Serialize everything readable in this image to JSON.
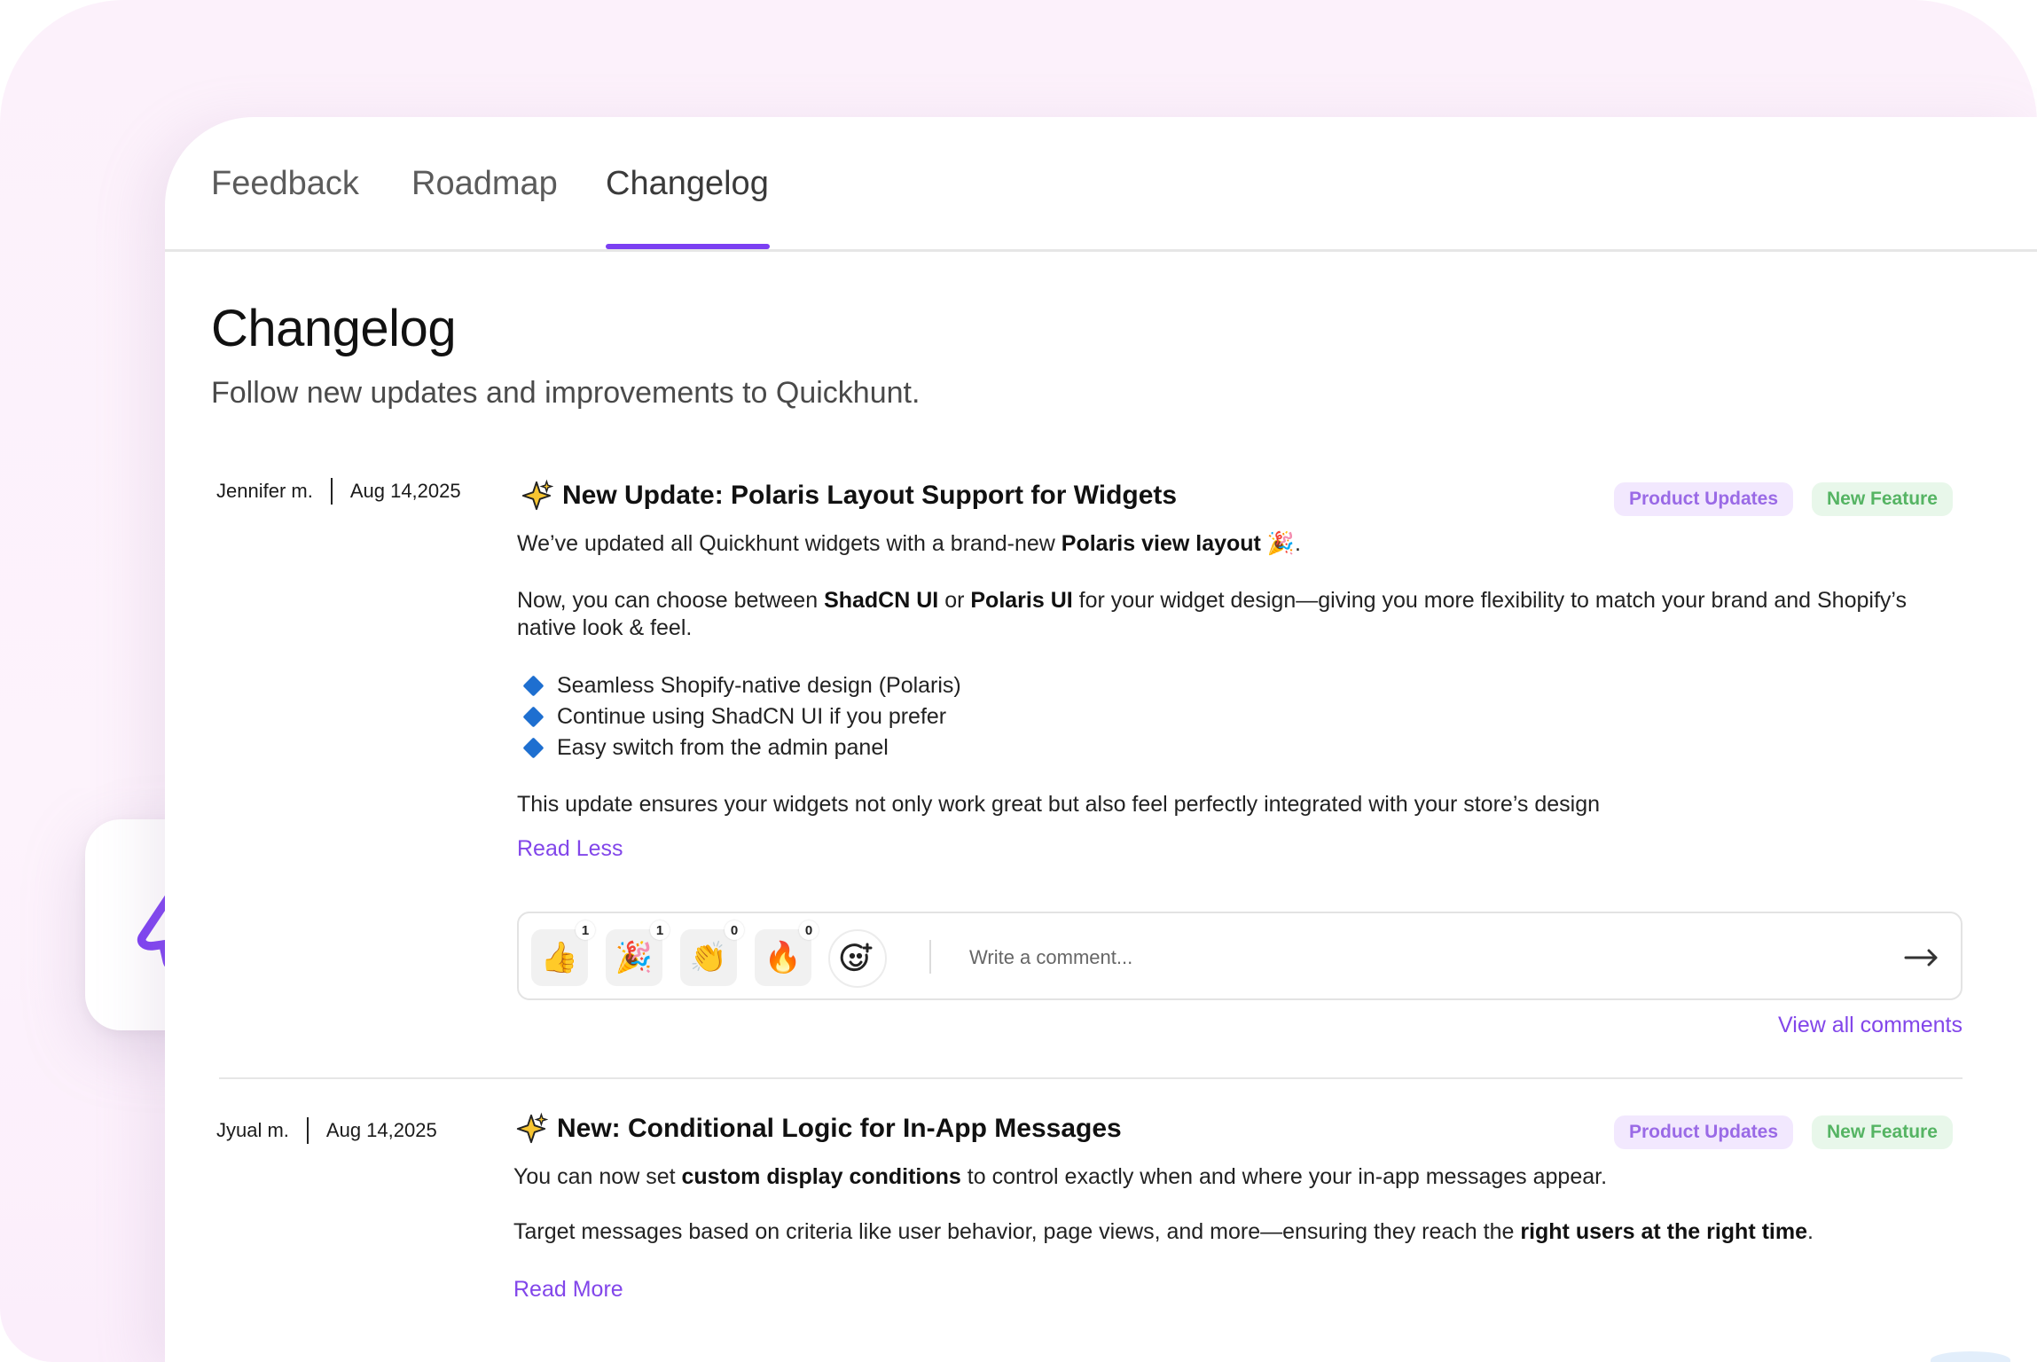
{
  "tabs": [
    {
      "label": "Feedback"
    },
    {
      "label": "Roadmap"
    },
    {
      "label": "Changelog",
      "active": true
    }
  ],
  "page": {
    "title": "Changelog",
    "subtitle": "Follow new updates and improvements to Quickhunt."
  },
  "posts": [
    {
      "author": "Jennifer m.",
      "date": "Aug 14,2025",
      "icon": "sparkles-icon",
      "title": "New Update: Polaris Layout Support for Widgets",
      "tags": [
        "Product Updates",
        "New Feature"
      ],
      "intro": {
        "pre": "We’ve updated all Quickhunt widgets with a brand-new ",
        "bold": "Polaris view layout",
        "emoji": "🎉",
        "post": "."
      },
      "choice": {
        "pre": "Now, you can choose between ",
        "bold1": "ShadCN UI",
        "mid": " or ",
        "bold2": "Polaris UI",
        "post": " for your widget design—giving you more flexibility to match your brand and Shopify’s native look & feel."
      },
      "bullets": [
        "Seamless Shopify-native design (Polaris)",
        "Continue using ShadCN UI if you prefer",
        "Easy switch from the admin panel"
      ],
      "closing": "This update ensures your widgets not only work great but also feel perfectly integrated with your store’s design",
      "read_link": "Read Less",
      "reactions": [
        {
          "icon": "thumbs-up-icon",
          "emoji": "👍",
          "count": "1"
        },
        {
          "icon": "party-popper-icon",
          "emoji": "🎉",
          "count": "1"
        },
        {
          "icon": "clapping-hands-icon",
          "emoji": "👏",
          "count": "0"
        },
        {
          "icon": "fire-icon",
          "emoji": "🔥",
          "count": "0"
        }
      ],
      "comment_placeholder": "Write a comment...",
      "view_all": "View all comments"
    },
    {
      "author": "Jyual m.",
      "date": "Aug 14,2025",
      "icon": "sparkles-icon",
      "title": "New: Conditional Logic for In-App Messages",
      "tags": [
        "Product Updates",
        "New Feature"
      ],
      "line1": {
        "pre": "You can now set ",
        "bold": "custom display conditions",
        "post": " to control exactly when and where your in-app messages appear."
      },
      "line2": {
        "pre": "Target messages based on criteria like user behavior, page views, and more—ensuring they reach the ",
        "bold": "right users at the right time",
        "post": "."
      },
      "read_link": "Read More"
    }
  ],
  "colors": {
    "accent": "#7b3ff2",
    "link": "#8246ea",
    "tag_purple_bg": "#f2e8fe",
    "tag_purple_text": "#9a6ae6",
    "tag_green_bg": "#e8f7ea",
    "tag_green_text": "#55b463",
    "bullet": "#1e6fd0"
  },
  "side_icon": "megaphone-icon"
}
